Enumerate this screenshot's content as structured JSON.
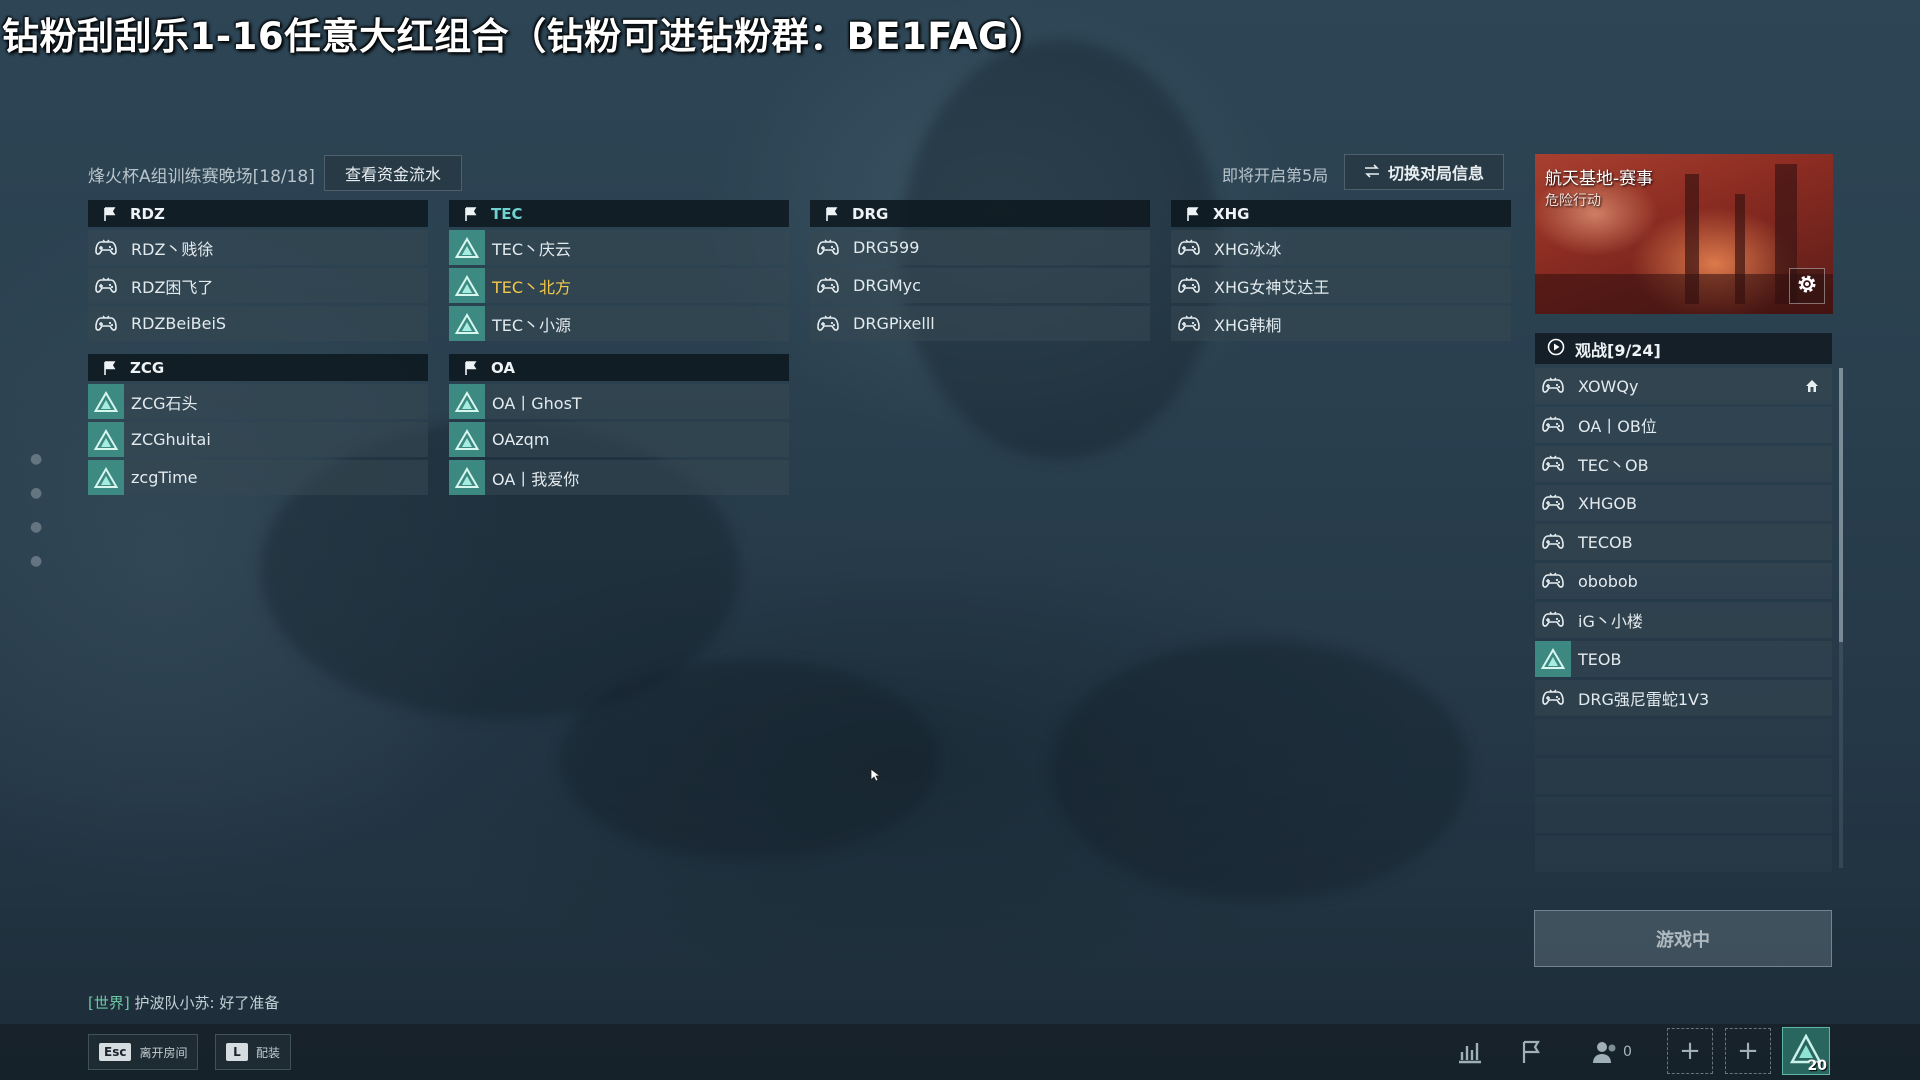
{
  "overlay": {
    "title": "钻粉刮刮乐1-16任意大红组合（钻粉可进钻粉群：BE1FAG）"
  },
  "header": {
    "room_title": "烽火杯A组训练赛晚场[18/18]",
    "funds_button": "查看资金流水",
    "next_round": "即将开启第5局",
    "switch_button": "切换对局信息",
    "switch_icon": "swap-arrows-icon"
  },
  "teams": [
    {
      "name": "RDZ",
      "accent": false,
      "players": [
        {
          "name": "RDZ丶贱徐",
          "icon": "gamepad-icon",
          "highlight": false
        },
        {
          "name": "RDZ困飞了",
          "icon": "gamepad-icon",
          "highlight": false
        },
        {
          "name": "RDZBeiBeiS",
          "icon": "gamepad-icon",
          "highlight": false
        }
      ]
    },
    {
      "name": "TEC",
      "accent": true,
      "players": [
        {
          "name": "TEC丶庆云",
          "icon": "triangle-icon",
          "highlight": false
        },
        {
          "name": "TEC丶北方",
          "icon": "triangle-icon",
          "highlight": true
        },
        {
          "name": "TEC丶小源",
          "icon": "triangle-icon",
          "highlight": false
        }
      ]
    },
    {
      "name": "DRG",
      "accent": false,
      "players": [
        {
          "name": "DRG599",
          "icon": "gamepad-icon",
          "highlight": false
        },
        {
          "name": "DRGMyc",
          "icon": "gamepad-icon",
          "highlight": false
        },
        {
          "name": "DRGPixelll",
          "icon": "gamepad-icon",
          "highlight": false
        }
      ]
    },
    {
      "name": "XHG",
      "accent": false,
      "players": [
        {
          "name": "XHG冰冰",
          "icon": "gamepad-icon",
          "highlight": false
        },
        {
          "name": "XHG女神艾达王",
          "icon": "gamepad-icon",
          "highlight": false
        },
        {
          "name": "XHG韩桐",
          "icon": "gamepad-icon",
          "highlight": false
        }
      ]
    },
    {
      "name": "ZCG",
      "accent": false,
      "players": [
        {
          "name": "ZCG石头",
          "icon": "triangle-icon",
          "highlight": false
        },
        {
          "name": "ZCGhuitai",
          "icon": "triangle-icon",
          "highlight": false
        },
        {
          "name": "zcgTime",
          "icon": "triangle-icon",
          "highlight": false
        }
      ]
    },
    {
      "name": "OA",
      "accent": false,
      "players": [
        {
          "name": "OA丨GhosT",
          "icon": "triangle-icon",
          "highlight": false
        },
        {
          "name": "OAzqm",
          "icon": "triangle-icon",
          "highlight": false
        },
        {
          "name": "OA丨我爱你",
          "icon": "triangle-icon",
          "highlight": false
        }
      ]
    }
  ],
  "map": {
    "name": "航天基地-赛事",
    "mode": "危险行动"
  },
  "spectate": {
    "title": "观战[9/24]",
    "rows": [
      {
        "name": "XOWQy",
        "icon": "gamepad-icon",
        "host": true
      },
      {
        "name": "OA丨OB位",
        "icon": "gamepad-icon",
        "host": false
      },
      {
        "name": "TEC丶OB",
        "icon": "gamepad-icon",
        "host": false
      },
      {
        "name": "XHGOB",
        "icon": "gamepad-icon",
        "host": false
      },
      {
        "name": "TECOB",
        "icon": "gamepad-icon",
        "host": false
      },
      {
        "name": "obobob",
        "icon": "gamepad-icon",
        "host": false
      },
      {
        "name": "iG丶小楼",
        "icon": "gamepad-icon",
        "host": false
      },
      {
        "name": "TEOB",
        "icon": "triangle-icon",
        "host": false
      },
      {
        "name": "DRG强尼雷蛇1V3",
        "icon": "gamepad-icon",
        "host": false
      }
    ],
    "empty_slots": 4
  },
  "ingame_button": "游戏中",
  "chat": {
    "channel": "[世界]",
    "text": "护波队小苏: 好了准备"
  },
  "bottom": {
    "esc_key": "Esc",
    "esc_label": "离开房间",
    "l_key": "L",
    "l_label": "配装",
    "friend_count": "0",
    "rank_number": "20"
  },
  "colors": {
    "accent_teal": "#6fd3d1",
    "highlight_yellow": "#f4c84a",
    "chat_green": "#6cc8a4"
  }
}
